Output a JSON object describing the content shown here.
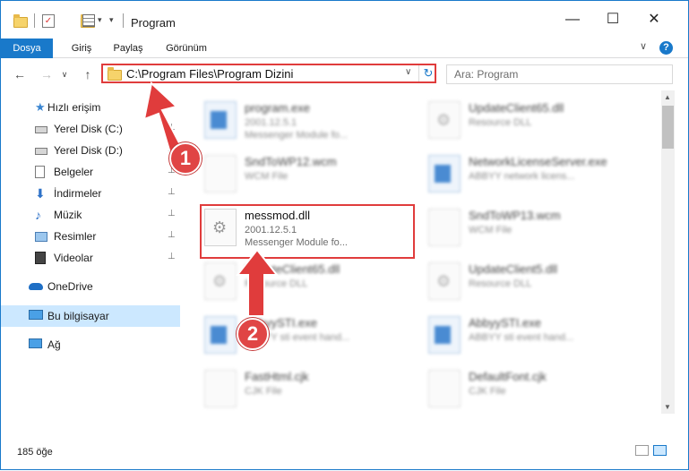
{
  "window": {
    "title": "Program",
    "controls": {
      "minimize": "—",
      "maximize": "☐",
      "close": "✕"
    }
  },
  "ribbon": {
    "tabs": [
      {
        "label": "Dosya",
        "active": true
      },
      {
        "label": "Giriş"
      },
      {
        "label": "Paylaş"
      },
      {
        "label": "Görünüm"
      }
    ],
    "help": "?",
    "collapse": "∨"
  },
  "nav": {
    "back": "←",
    "forward": "→",
    "recent": "∨",
    "up": "↑",
    "address": "C:\\Program Files\\Program Dizini",
    "address_dropdown": "∨",
    "refresh": "↻",
    "search_placeholder": "Ara: Program"
  },
  "sidebar": {
    "items": [
      {
        "label": "Hızlı erişim",
        "icon": "star-icon"
      },
      {
        "label": "Yerel Disk (C:)",
        "icon": "drive-icon",
        "pinned": true
      },
      {
        "label": "Yerel Disk (D:)",
        "icon": "drive-icon",
        "pinned": true
      },
      {
        "label": "Belgeler",
        "icon": "documents-icon",
        "pinned": true
      },
      {
        "label": "İndirmeler",
        "icon": "downloads-icon",
        "pinned": true
      },
      {
        "label": "Müzik",
        "icon": "music-icon",
        "pinned": true
      },
      {
        "label": "Resimler",
        "icon": "pictures-icon",
        "pinned": true
      },
      {
        "label": "Videolar",
        "icon": "videos-icon",
        "pinned": true
      },
      {
        "label": "OneDrive",
        "icon": "cloud-icon"
      },
      {
        "label": "Bu bilgisayar",
        "icon": "computer-icon",
        "selected": true
      },
      {
        "label": "Ağ",
        "icon": "network-icon"
      }
    ],
    "pin_glyph": "📌"
  },
  "files": {
    "col1": [
      {
        "name": "program.exe",
        "line2": "2001.12.5.1",
        "line3": "Messenger Module fo...",
        "icon": "exe-icon"
      },
      {
        "name": "SndToWP12.wcm",
        "line2": "WCM File",
        "line3": "",
        "icon": "file-icon"
      },
      {
        "name": "messmod.dll",
        "line2": "2001.12.5.1",
        "line3": "Messenger Module fo...",
        "icon": "dll-icon"
      },
      {
        "name": "UpdateClient65.dll",
        "line2": "Resource DLL",
        "line3": "",
        "icon": "dll-icon"
      },
      {
        "name": "AbbyySTI.exe",
        "line2": "ABBYY sti event hand...",
        "line3": "",
        "icon": "exe-icon"
      },
      {
        "name": "FastHtml.cjk",
        "line2": "CJK File",
        "line3": "",
        "icon": "file-icon"
      }
    ],
    "col2": [
      {
        "name": "UpdateClient65.dll",
        "line2": "Resource DLL",
        "line3": "",
        "icon": "dll-icon"
      },
      {
        "name": "NetworkLicenseServer.exe",
        "line2": "ABBYY network licens...",
        "line3": "",
        "icon": "exe-icon"
      },
      {
        "name": "SndToWP13.wcm",
        "line2": "WCM File",
        "line3": "",
        "icon": "file-icon"
      },
      {
        "name": "UpdateClient5.dll",
        "line2": "Resource DLL",
        "line3": "",
        "icon": "dll-icon"
      },
      {
        "name": "AbbyySTI.exe",
        "line2": "ABBYY sti event hand...",
        "line3": "",
        "icon": "exe-icon"
      },
      {
        "name": "DefaultFont.cjk",
        "line2": "CJK File",
        "line3": "",
        "icon": "file-icon"
      }
    ]
  },
  "status": {
    "count": "185 öğe"
  },
  "annotations": {
    "badge1": "1",
    "badge2": "2",
    "accent": "#e03c3c"
  }
}
